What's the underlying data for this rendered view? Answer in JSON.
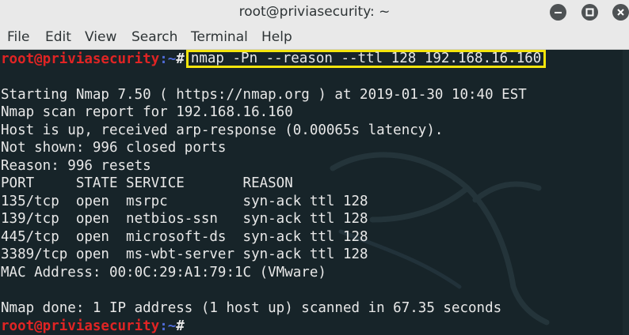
{
  "window": {
    "title": "root@priviasecurity: ~",
    "buttons": [
      "minimize",
      "maximize",
      "close"
    ]
  },
  "menu": {
    "items": [
      "File",
      "Edit",
      "View",
      "Search",
      "Terminal",
      "Help"
    ]
  },
  "terminal": {
    "prompt_user_host": "root@priviasecurity",
    "prompt_path": ":~",
    "prompt_symbol": "#",
    "command": "nmap -Pn --reason --ttl 128 192.168.16.160",
    "output": [
      "",
      "Starting Nmap 7.50 ( https://nmap.org ) at 2019-01-30 10:40 EST",
      "Nmap scan report for 192.168.16.160",
      "Host is up, received arp-response (0.00065s latency).",
      "Not shown: 996 closed ports",
      "Reason: 996 resets",
      "PORT     STATE SERVICE       REASON",
      "135/tcp  open  msrpc         syn-ack ttl 128",
      "139/tcp  open  netbios-ssn   syn-ack ttl 128",
      "445/tcp  open  microsoft-ds  syn-ack ttl 128",
      "3389/tcp open  ms-wbt-server syn-ack ttl 128",
      "MAC Address: 00:0C:29:A1:79:1C (VMware)",
      "",
      "Nmap done: 1 IP address (1 host up) scanned in 67.35 seconds"
    ],
    "highlight_color": "#f5e50c"
  }
}
